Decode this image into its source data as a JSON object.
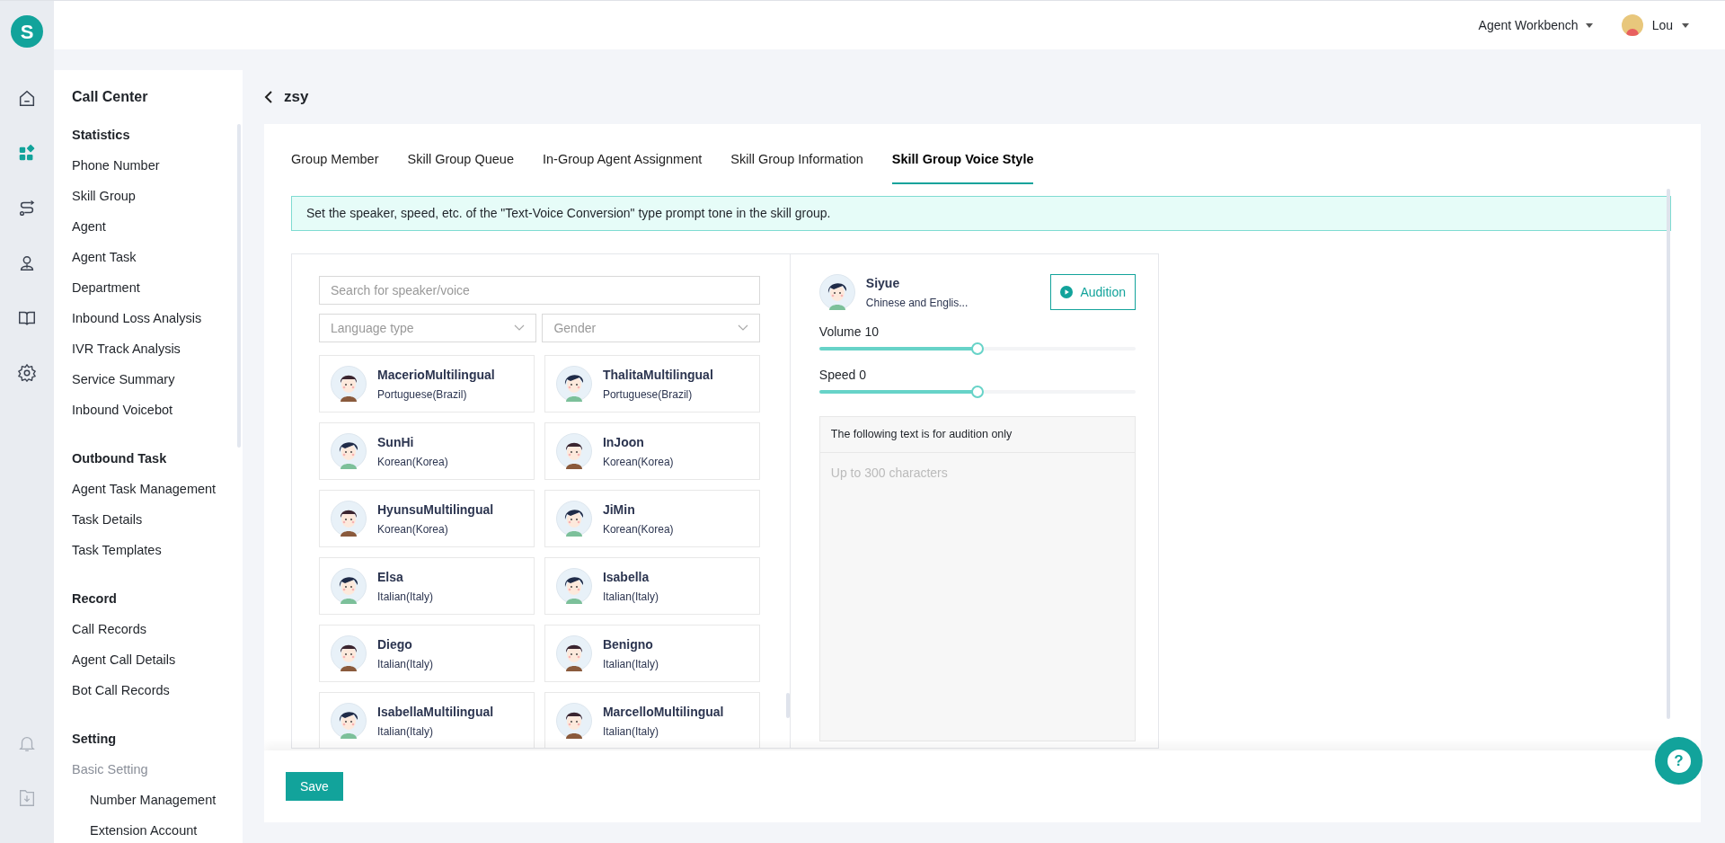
{
  "logo": {
    "text": "S"
  },
  "rail": {
    "items": [
      {
        "selected": false
      },
      {
        "selected": true
      },
      {
        "selected": false
      },
      {
        "selected": false
      },
      {
        "selected": false
      },
      {
        "selected": false
      }
    ]
  },
  "topbar": {
    "workbench": "Agent Workbench",
    "user": "Lou"
  },
  "sidebar": {
    "title": "Call Center",
    "sections": [
      {
        "title": "Statistics",
        "items": [
          {
            "label": "Phone Number"
          },
          {
            "label": "Skill Group"
          },
          {
            "label": "Agent"
          },
          {
            "label": "Agent Task"
          },
          {
            "label": "Department"
          },
          {
            "label": "Inbound Loss Analysis"
          },
          {
            "label": "IVR Track Analysis"
          },
          {
            "label": "Service Summary"
          },
          {
            "label": "Inbound Voicebot"
          }
        ]
      },
      {
        "title": "Outbound Task",
        "items": [
          {
            "label": "Agent Task Management"
          },
          {
            "label": "Task Details"
          },
          {
            "label": "Task Templates"
          }
        ]
      },
      {
        "title": "Record",
        "items": [
          {
            "label": "Call Records"
          },
          {
            "label": "Agent Call Details"
          },
          {
            "label": "Bot Call Records"
          }
        ]
      },
      {
        "title": "Setting",
        "items": [
          {
            "label": "Basic Setting",
            "children": [
              {
                "label": "Number Management"
              },
              {
                "label": "Extension Account"
              }
            ]
          }
        ]
      }
    ]
  },
  "page": {
    "title": "zsy"
  },
  "tabs": [
    {
      "label": "Group Member",
      "selected": false
    },
    {
      "label": "Skill Group Queue",
      "selected": false
    },
    {
      "label": "In-Group Agent Assignment",
      "selected": false
    },
    {
      "label": "Skill Group Information",
      "selected": false
    },
    {
      "label": "Skill Group Voice Style",
      "selected": true
    }
  ],
  "notice": "Set the speaker, speed, etc. of the \"Text-Voice Conversion\" type prompt tone in the skill group.",
  "search": {
    "placeholder": "Search for speaker/voice"
  },
  "filters": [
    {
      "placeholder": "Language type"
    },
    {
      "placeholder": "Gender"
    }
  ],
  "voices": [
    {
      "name": "MacerioMultilingual",
      "language": "Portuguese(Brazil)",
      "kind": "male"
    },
    {
      "name": "ThalitaMultilingual",
      "language": "Portuguese(Brazil)",
      "kind": "female"
    },
    {
      "name": "SunHi",
      "language": "Korean(Korea)",
      "kind": "female"
    },
    {
      "name": "InJoon",
      "language": "Korean(Korea)",
      "kind": "male"
    },
    {
      "name": "HyunsuMultilingual",
      "language": "Korean(Korea)",
      "kind": "male"
    },
    {
      "name": "JiMin",
      "language": "Korean(Korea)",
      "kind": "female"
    },
    {
      "name": "Elsa",
      "language": "Italian(Italy)",
      "kind": "female"
    },
    {
      "name": "Isabella",
      "language": "Italian(Italy)",
      "kind": "female"
    },
    {
      "name": "Diego",
      "language": "Italian(Italy)",
      "kind": "male"
    },
    {
      "name": "Benigno",
      "language": "Italian(Italy)",
      "kind": "male"
    },
    {
      "name": "IsabellaMultilingual",
      "language": "Italian(Italy)",
      "kind": "female"
    },
    {
      "name": "MarcelloMultilingual",
      "language": "Italian(Italy)",
      "kind": "male"
    }
  ],
  "selected_voice": {
    "name": "Siyue",
    "language": "Chinese and Englis...",
    "kind": "female",
    "audition_button": "Audition"
  },
  "sliders": [
    {
      "label": "Volume 10",
      "level": 0.5
    },
    {
      "label": "Speed 0",
      "level": 0.5
    }
  ],
  "audition_text": {
    "header": "The following text is for audition only",
    "placeholder": "Up to 300 characters"
  },
  "save_button": "Save",
  "help_button": {
    "glyph": "?"
  }
}
